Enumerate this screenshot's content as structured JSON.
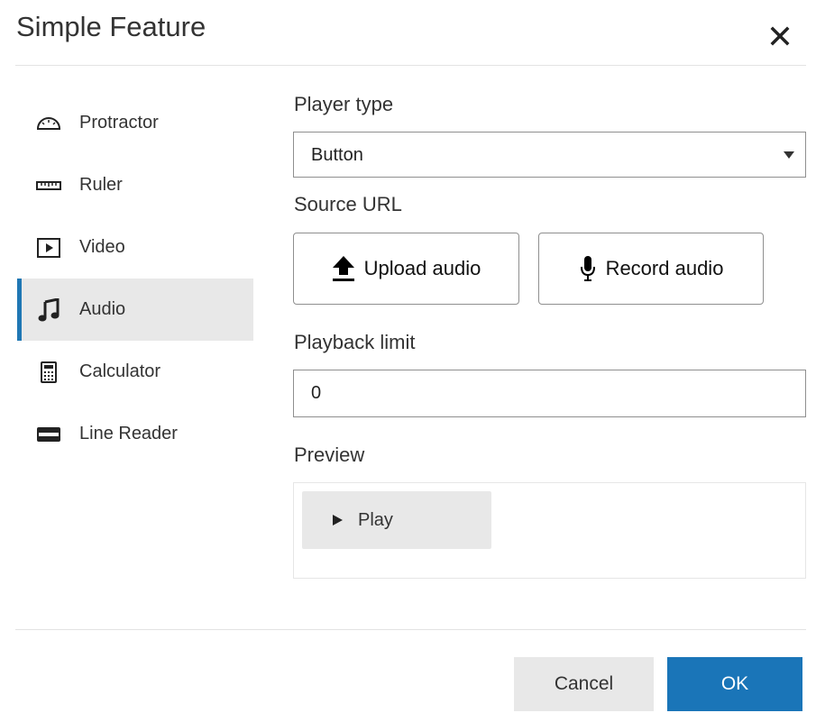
{
  "dialog": {
    "title": "Simple Feature",
    "close_icon": "close-icon"
  },
  "sidebar": {
    "items": [
      {
        "label": "Protractor",
        "icon": "protractor-icon",
        "active": false
      },
      {
        "label": "Ruler",
        "icon": "ruler-icon",
        "active": false
      },
      {
        "label": "Video",
        "icon": "video-icon",
        "active": false
      },
      {
        "label": "Audio",
        "icon": "music-note-icon",
        "active": true
      },
      {
        "label": "Calculator",
        "icon": "calculator-icon",
        "active": false
      },
      {
        "label": "Line Reader",
        "icon": "line-reader-icon",
        "active": false
      }
    ],
    "active_color": "#1f77b4"
  },
  "form": {
    "player_type": {
      "label": "Player type",
      "value": "Button"
    },
    "source_url": {
      "label": "Source URL",
      "upload_label": "Upload audio",
      "upload_icon": "upload-icon",
      "record_label": "Record audio",
      "record_icon": "microphone-icon"
    },
    "playback_limit": {
      "label": "Playback limit",
      "value": "0"
    },
    "preview": {
      "label": "Preview",
      "play_label": "Play",
      "play_icon": "play-icon"
    }
  },
  "footer": {
    "cancel_label": "Cancel",
    "ok_label": "OK",
    "ok_color": "#1a75b8"
  }
}
